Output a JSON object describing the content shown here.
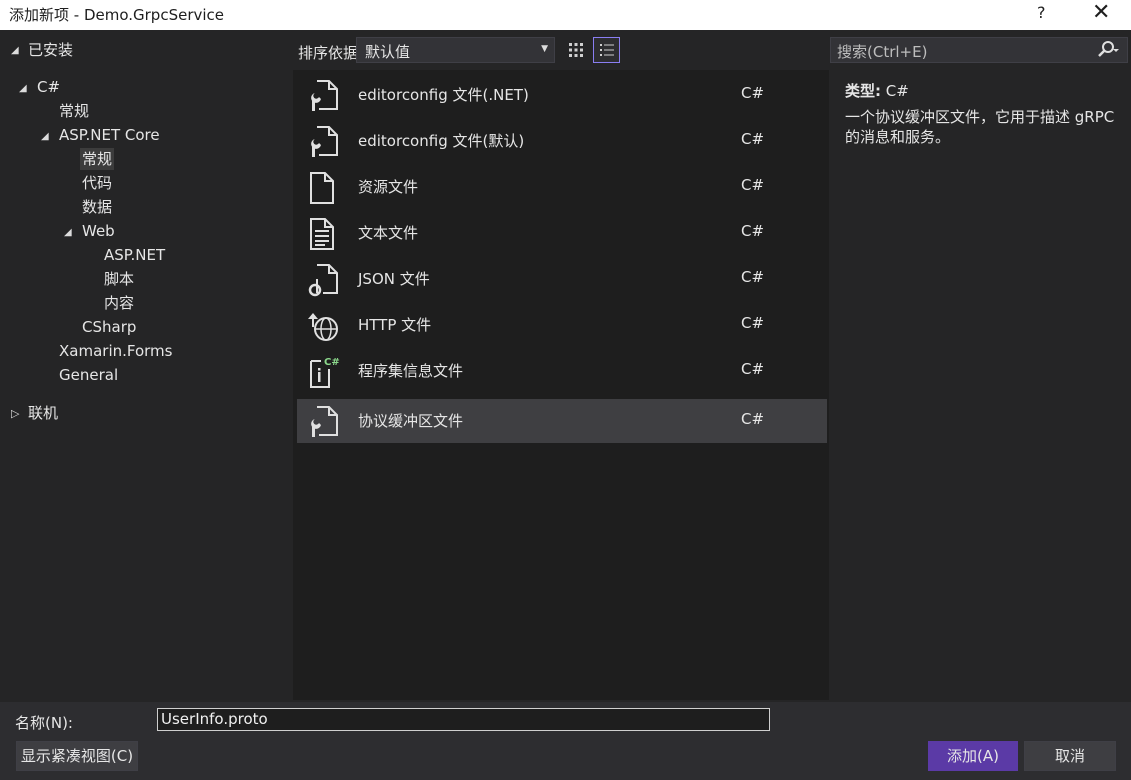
{
  "window": {
    "title": "添加新项 - Demo.GrpcService",
    "help": "?",
    "close": "✕"
  },
  "tree": {
    "installed": "已安装",
    "csharp": "C#",
    "general": "常规",
    "aspnetcore": "ASP.NET Core",
    "aspnetcore_children": {
      "general": "常规",
      "code": "代码",
      "data": "数据",
      "web": "Web"
    },
    "web_children": {
      "aspnet": "ASP.NET",
      "script": "脚本",
      "content": "内容"
    },
    "csharp_item": "CSharp",
    "xamarin": "Xamarin.Forms",
    "general_en": "General",
    "online": "联机"
  },
  "toolbar": {
    "sort_label": "排序依据:",
    "sort_value": "默认值",
    "search_placeholder": "搜索(Ctrl+E)"
  },
  "items": [
    {
      "name": "editorconfig 文件(.NET)",
      "lang": "C#",
      "icon": "config-file-icon"
    },
    {
      "name": "editorconfig 文件(默认)",
      "lang": "C#",
      "icon": "config-file-icon"
    },
    {
      "name": "资源文件",
      "lang": "C#",
      "icon": "resource-file-icon"
    },
    {
      "name": "文本文件",
      "lang": "C#",
      "icon": "text-file-icon"
    },
    {
      "name": "JSON 文件",
      "lang": "C#",
      "icon": "json-file-icon"
    },
    {
      "name": "HTTP 文件",
      "lang": "C#",
      "icon": "http-file-icon"
    },
    {
      "name": "程序集信息文件",
      "lang": "C#",
      "icon": "assembly-info-icon"
    },
    {
      "name": "协议缓冲区文件",
      "lang": "C#",
      "icon": "config-file-icon",
      "selected": true
    }
  ],
  "details": {
    "type_label": "类型:",
    "type_value": "C#",
    "description": "一个协议缓冲区文件，它用于描述 gRPC 的消息和服务。"
  },
  "bottom": {
    "name_label": "名称(N):",
    "name_value": "UserInfo.proto",
    "compact_view": "显示紧凑视图(C)",
    "add": "添加(A)",
    "cancel": "取消"
  },
  "colors": {
    "accent": "#5b3aa6",
    "selected_row": "#3f3f42",
    "list_bg": "#1e1e1e"
  }
}
